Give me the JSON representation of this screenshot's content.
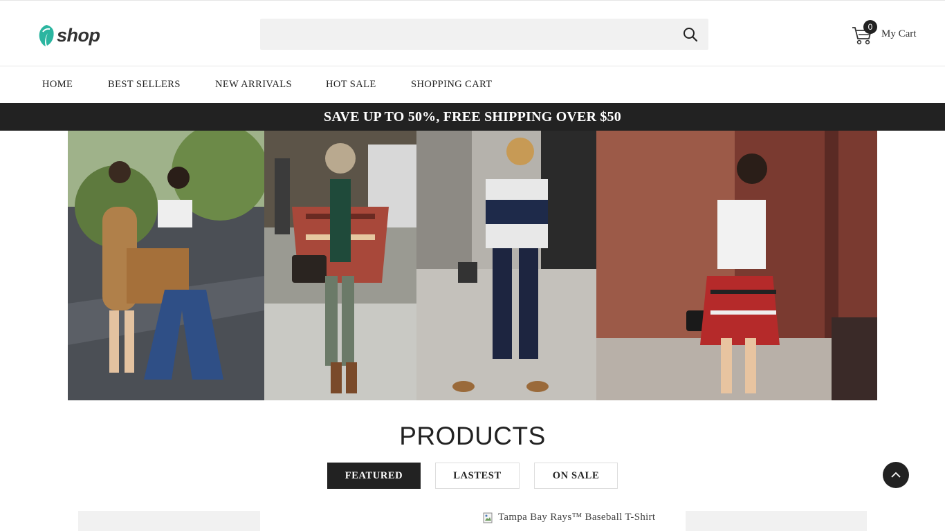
{
  "brand": {
    "logo_text": "shop"
  },
  "search": {
    "placeholder": ""
  },
  "cart": {
    "count": "0",
    "label": "My Cart"
  },
  "nav": {
    "items": [
      "HOME",
      "BEST SELLERS",
      "NEW ARRIVALS",
      "HOT SALE",
      "SHOPPING CART"
    ]
  },
  "promo": {
    "text": "SAVE UP TO 50%, FREE SHIPPING OVER $50"
  },
  "products": {
    "title": "PRODUCTS",
    "tabs": [
      "FEATURED",
      "LASTEST",
      "ON SALE"
    ],
    "active_tab": "FEATURED",
    "broken_image_alt": "Tampa Bay Rays™ Baseball T-Shirt"
  },
  "colors": {
    "accent": "#222222",
    "brand_teal": "#2bb5a0",
    "search_bg": "#f1f1f1"
  }
}
